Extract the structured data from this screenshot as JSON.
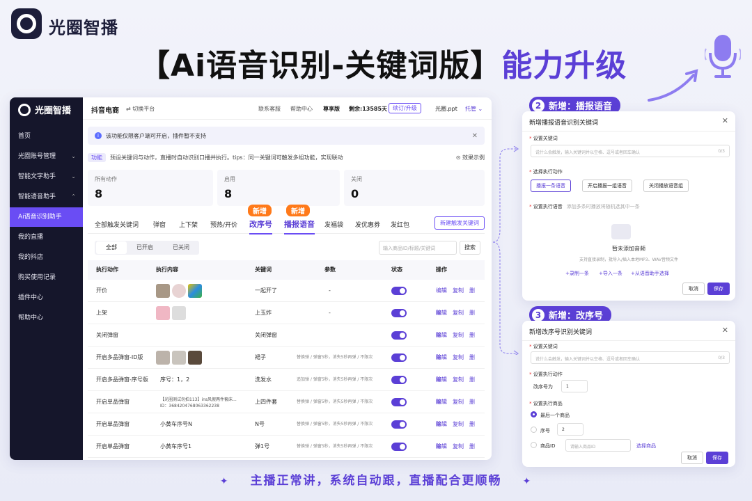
{
  "brand": {
    "name": "光圈智播",
    "colors": {
      "accent": "#5b3fd6",
      "sidebar": "#15162b",
      "badge": "#ff7a1a"
    }
  },
  "headline": {
    "main": "【Ai语音识别-关键词版】",
    "accent": "能力升级"
  },
  "app": {
    "sidebar": {
      "logo": "光圈智播",
      "items": [
        {
          "label": "首页"
        },
        {
          "label": "光圈账号管理",
          "chevron": "⌄"
        },
        {
          "label": "智能文字助手",
          "chevron": "⌄"
        },
        {
          "label": "智能语音助手",
          "chevron": "⌃"
        },
        {
          "label": "Ai语音识别助手",
          "active": true
        },
        {
          "label": "我的直播"
        },
        {
          "label": "我的抖店"
        },
        {
          "label": "购买使用记录"
        },
        {
          "label": "插件中心"
        },
        {
          "label": "帮助中心"
        }
      ]
    },
    "topbar": {
      "title": "抖音电商",
      "switch": "切换平台",
      "service": "联系客服",
      "help": "帮助中心",
      "edition": "尊享版",
      "remain": "剩余:13585天",
      "renew": "续订/升级",
      "file": "光圈.ppt",
      "hosting": "托管"
    },
    "alert": {
      "text": "该功能仅限客户端可开启，插件暂不支持",
      "close": "✕"
    },
    "func": {
      "tag": "功能",
      "text": "预设关键词与动作，直播时自动识别口播并执行。tips：同一关键词可触发多组功能，实现联动",
      "example": "效果示例"
    },
    "stats": [
      {
        "label": "所有动作",
        "value": "8"
      },
      {
        "label": "启用",
        "value": "8"
      },
      {
        "label": "关闭",
        "value": "0"
      }
    ],
    "tabs": [
      "全部触发关键词",
      "弹窗",
      "上下架",
      "预热/开价",
      "改序号",
      "播报语音",
      "发福袋",
      "发优惠券",
      "发红包"
    ],
    "new_badge": "新增",
    "add_keyword": "新建触发关键词",
    "filters": [
      "全部",
      "已开启",
      "已关闭"
    ],
    "search": {
      "placeholder": "输入商品ID/标题/关键词",
      "button": "搜索"
    },
    "columns": [
      "执行动作",
      "执行内容",
      "关键词",
      "参数",
      "状态",
      "操作"
    ],
    "rows": [
      {
        "action": "开价",
        "content": "",
        "keyword": "一起开了",
        "param": "-"
      },
      {
        "action": "上架",
        "content": "",
        "keyword": "上玉炸",
        "param": "-"
      },
      {
        "action": "关闭弹窗",
        "content": "",
        "keyword": "关闭弹窗",
        "param": ""
      },
      {
        "action": "开启多品弹窗-ID版",
        "content": "",
        "keyword": "裙子",
        "param": "替换弹 / 弹窗5秒，消失5秒再弹 / 不限次"
      },
      {
        "action": "开启多品弹窗-序号版",
        "content": "序号：1，2",
        "keyword": "洗发水",
        "param": "追加弹 / 弹窗5秒，消失5秒再弹 / 不限次"
      },
      {
        "action": "开启单品弹窗",
        "content": "【光圈测试勿拍113】ins风假两件套床...",
        "content2": "ID：3684204768063362238",
        "keyword": "上四件套",
        "param": "替换弹 / 弹窗5秒，消失5秒再弹 / 不限次"
      },
      {
        "action": "开启单品弹窗",
        "content": "小黄车序号N",
        "keyword": "N号",
        "param": "替换弹 / 弹窗5秒，消失5秒再弹 / 不限次"
      },
      {
        "action": "开启单品弹窗",
        "content": "小黄车序号1",
        "keyword": "弹1号",
        "param": "替换弹 / 弹窗5秒，消失5秒再弹 / 不限次"
      }
    ],
    "ops": [
      "编辑",
      "复制",
      "删除"
    ]
  },
  "panel1": {
    "label_num": "2",
    "label": "新增：播报语音",
    "title": "新增播报语音识别关键词",
    "kw_label": "设置关键词",
    "kw_placeholder": "说什么会触发，输入关键词并以空格、逗号或者回车确认",
    "kw_count": "0/3",
    "action_label": "选择执行动作",
    "actions": [
      "播报一条语音",
      "开启播报一组语音",
      "关闭播放语音组"
    ],
    "voice_label": "设置执行语音",
    "voice_hint": "添加多条时播放将随机选其中一条",
    "empty": "暂未添加音频",
    "empty_hint": "支持直接录制，批导入/插入本地MP3、WAV音频文件",
    "links": [
      "+录制一条",
      "+导入一条",
      "+从语音助手选择"
    ],
    "cancel": "取消",
    "save": "保存"
  },
  "panel2": {
    "label_num": "3",
    "label": "新增：改序号",
    "title": "新增改序号识别关键词",
    "kw_label": "设置关键词",
    "kw_placeholder": "说什么会触发，输入关键词并以空格、逗号或者回车确认",
    "kw_count": "0/3",
    "action_label": "设置执行动作",
    "seq_label": "改序号为",
    "seq_value": "1",
    "goods_label": "设置执行商品",
    "opt_last": "最后一个商品",
    "opt_seq": "序号",
    "opt_seq_value": "2",
    "opt_id": "商品ID",
    "id_placeholder": "请输入商品ID",
    "select_goods": "选择商品",
    "cancel": "取消",
    "save": "保存"
  },
  "footer": {
    "slogan": "主播正常讲，系统自动跟，直播配合更顺畅",
    "star": "✦"
  }
}
